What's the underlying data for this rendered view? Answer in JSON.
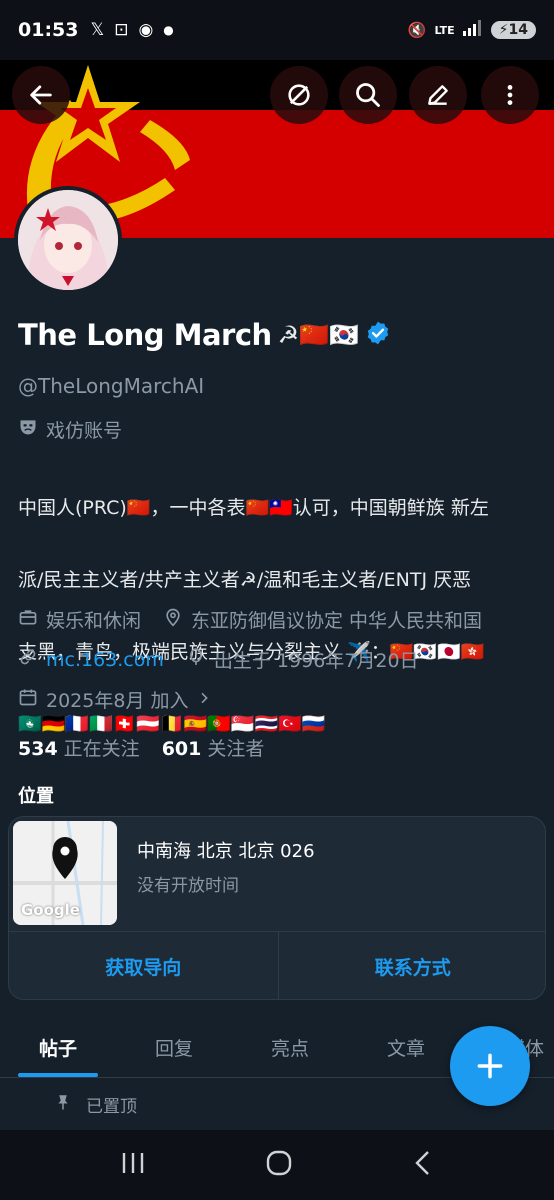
{
  "status_bar": {
    "time": "01:53",
    "battery": "14",
    "network": "LTE"
  },
  "header": {
    "back_icon": "arrow-left-icon",
    "actions": [
      "mute-icon",
      "search-icon",
      "edit-icon",
      "more-vertical-icon"
    ]
  },
  "profile": {
    "name": "The Long March",
    "name_emoji": "☭🇨🇳🇰🇷",
    "handle": "@TheLongMarchAI",
    "parody_label": "戏仿账号",
    "bio_lines": [
      "中国人(PRC)🇨🇳，一中各表🇨🇳🇹🇼认可，中国朝鲜族 新左",
      "派/民主主义者/共产主义者☭/温和毛主义者/ENTJ 厌恶",
      "支黑，青鸟，极端民族主义与分裂主义 ✈️：🇨🇳🇰🇷🇯🇵🇭🇰",
      "🇲🇴🇩🇪🇫🇷🇮🇹🇨🇭🇦🇹🇧🇪🇪🇸🇵🇹🇸🇬🇹🇭🇹🇷🇷🇺"
    ],
    "category": "娱乐和休闲",
    "location": "东亚防御倡议协定 中华人民共和国",
    "website": "mc.163.com",
    "birthday": "出生于 1996年7月20日",
    "joined": "2025年8月 加入",
    "following_count": "534",
    "following_label": "正在关注",
    "followers_count": "601",
    "followers_label": "关注者"
  },
  "location_card": {
    "title": "位置",
    "address": "中南海 北京 北京 026",
    "hours": "没有开放时间",
    "map_label": "Google",
    "directions_button": "获取导向",
    "contact_button": "联系方式"
  },
  "tabs": [
    "帖子",
    "回复",
    "亮点",
    "文章",
    "媒体"
  ],
  "pinned_label": "已置顶",
  "colors": {
    "background": "#15202b",
    "accent": "#1d9bf0",
    "banner_red": "#d40000",
    "muted_text": "#8b98a5"
  }
}
